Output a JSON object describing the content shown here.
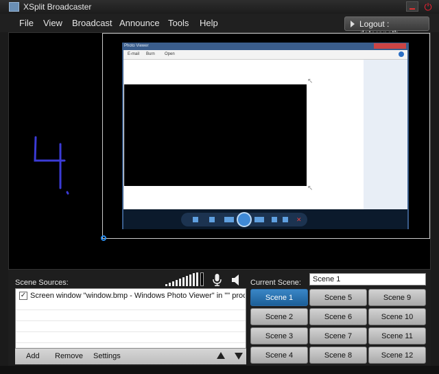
{
  "window": {
    "title": "XSplit Broadcaster"
  },
  "menu": [
    "File",
    "View",
    "Broadcast",
    "Announce",
    "Tools",
    "Help"
  ],
  "account": {
    "logout_label": "Logout : dateranoth"
  },
  "preview": {
    "photo_viewer": {
      "title": "Photo Viewer",
      "menu": [
        "E-mail",
        "Burn",
        "Open"
      ]
    }
  },
  "sources": {
    "label": "Scene Sources:",
    "items": [
      {
        "checked": true,
        "label": "Screen window \"window.bmp - Windows Photo Viewer\" in \"\" process"
      }
    ],
    "buttons": {
      "add": "Add",
      "remove": "Remove",
      "settings": "Settings"
    }
  },
  "scenes": {
    "current_label": "Current Scene:",
    "current_value": "Scene 1",
    "active": "Scene 1",
    "buttons": [
      "Scene 1",
      "Scene 2",
      "Scene 3",
      "Scene 4",
      "Scene 5",
      "Scene 6",
      "Scene 7",
      "Scene 8",
      "Scene 9",
      "Scene 10",
      "Scene 11",
      "Scene 12"
    ]
  },
  "colors": {
    "accent": "#2a6aa5",
    "power": "#e23333"
  }
}
